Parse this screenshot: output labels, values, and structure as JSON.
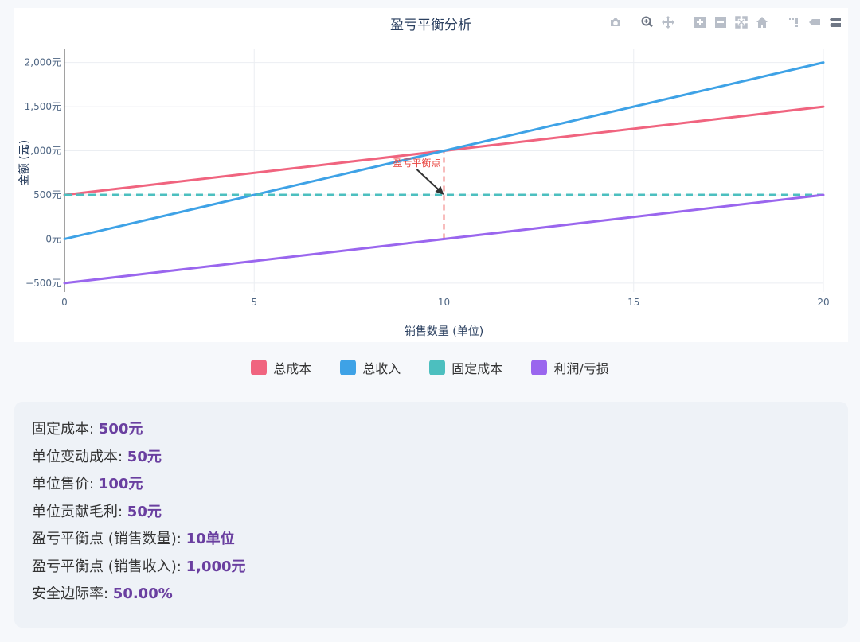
{
  "chart_data": {
    "type": "line",
    "title": "盈亏平衡分析",
    "xlabel": "销售数量 (单位)",
    "ylabel": "金额 (元)",
    "xlim": [
      0,
      20
    ],
    "ylim": [
      -600,
      2150
    ],
    "x_ticks": [
      0,
      5,
      10,
      15,
      20
    ],
    "x_tick_labels": [
      "0",
      "5",
      "10",
      "15",
      "20"
    ],
    "y_ticks": [
      -500,
      0,
      500,
      1000,
      1500,
      2000
    ],
    "y_tick_labels": [
      "−500元",
      "0元",
      "500元",
      "1,000元",
      "1,500元",
      "2,000元"
    ],
    "grid": true,
    "legend_position": "bottom-center",
    "series": [
      {
        "name": "总成本",
        "color": "#f0647f",
        "dash": "solid",
        "x": [
          0,
          20
        ],
        "y": [
          500,
          1500
        ]
      },
      {
        "name": "总收入",
        "color": "#3ea2e6",
        "dash": "solid",
        "x": [
          0,
          20
        ],
        "y": [
          0,
          2000
        ]
      },
      {
        "name": "固定成本",
        "color": "#4cbfbf",
        "dash": "dashed",
        "x": [
          0,
          20
        ],
        "y": [
          500,
          500
        ]
      },
      {
        "name": "利润/亏损",
        "color": "#9a66ee",
        "dash": "solid",
        "x": [
          0,
          20
        ],
        "y": [
          -500,
          500
        ]
      }
    ],
    "annotation": {
      "text": "盈亏平衡点",
      "color": "#e8433e",
      "point": [
        10,
        500
      ],
      "vline": {
        "x": 10,
        "y": [
          0,
          1000
        ],
        "color": "#f07b7b"
      }
    }
  },
  "legend": [
    {
      "label": "总成本",
      "color": "#f0647f"
    },
    {
      "label": "总收入",
      "color": "#3ea2e6"
    },
    {
      "label": "固定成本",
      "color": "#4cbfbf"
    },
    {
      "label": "利润/亏损",
      "color": "#9a66ee"
    }
  ],
  "modebar": {
    "icons": [
      "camera-icon",
      "zoom-icon",
      "pan-icon",
      "zoom-in-icon",
      "zoom-out-icon",
      "autoscale-icon",
      "home-icon",
      "spike-lines-icon",
      "hover-closest-icon",
      "hover-compare-icon"
    ]
  },
  "info": [
    {
      "label": "固定成本",
      "value": "500元"
    },
    {
      "label": "单位变动成本",
      "value": "50元"
    },
    {
      "label": "单位售价",
      "value": "100元"
    },
    {
      "label": "单位贡献毛利",
      "value": "50元"
    },
    {
      "label": "盈亏平衡点 (销售数量)",
      "value": "10单位"
    },
    {
      "label": "盈亏平衡点 (销售收入)",
      "value": "1,000元"
    },
    {
      "label": "安全边际率",
      "value": "50.00%"
    }
  ]
}
